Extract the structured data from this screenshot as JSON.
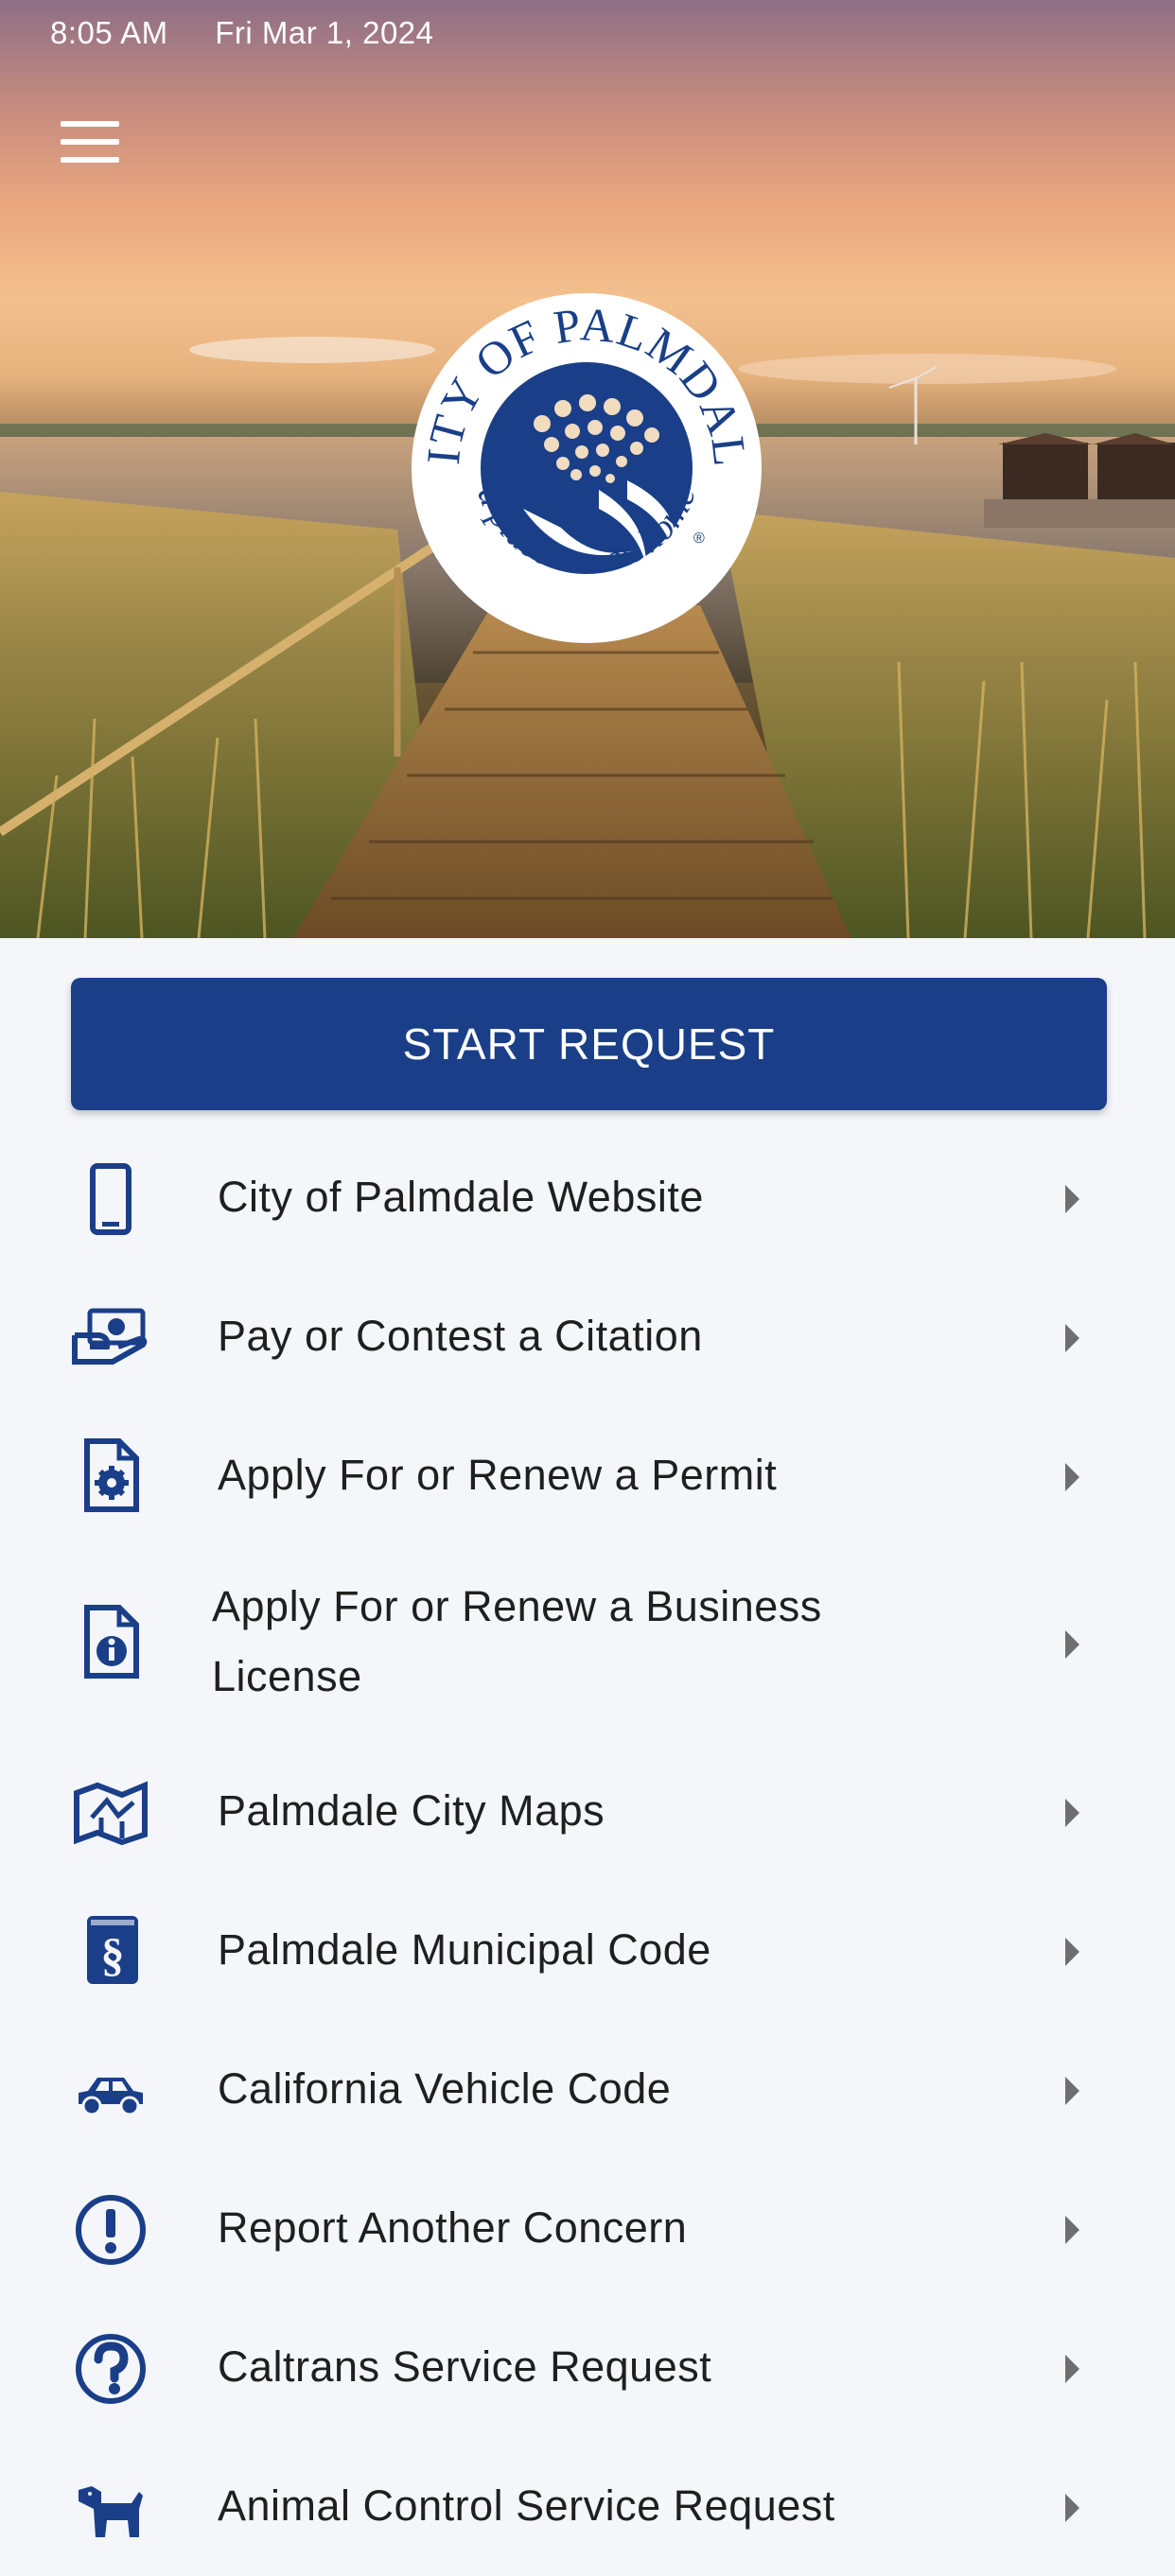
{
  "status_bar": {
    "time": "8:05 AM",
    "date": "Fri Mar 1, 2024"
  },
  "logo": {
    "top_text": "CITY OF PALMDALE",
    "bottom_text": "a place to call home",
    "registered": "®",
    "color": "#1a3f88"
  },
  "start_request": {
    "label": "START REQUEST",
    "color": "#1a3f88"
  },
  "menu": {
    "items": [
      {
        "label": "City of Palmdale Website",
        "icon": "tablet-icon"
      },
      {
        "label": "Pay or Contest a Citation",
        "icon": "money-hand-icon"
      },
      {
        "label": "Apply For or Renew a Permit",
        "icon": "file-gear-icon"
      },
      {
        "label": "Apply For or Renew a Business License",
        "icon": "file-info-icon"
      },
      {
        "label": "Palmdale City Maps",
        "icon": "map-icon"
      },
      {
        "label": "Palmdale Municipal Code",
        "icon": "law-book-icon"
      },
      {
        "label": "California Vehicle Code",
        "icon": "car-icon"
      },
      {
        "label": "Report Another Concern",
        "icon": "exclamation-circle-icon"
      },
      {
        "label": "Caltrans Service Request",
        "icon": "question-circle-icon"
      },
      {
        "label": "Animal Control Service Request",
        "icon": "dog-icon"
      }
    ]
  },
  "colors": {
    "accent": "#1a3f88",
    "background": "#f4f6fa",
    "text": "#1f1f1f",
    "caret": "#6e6e6e"
  }
}
